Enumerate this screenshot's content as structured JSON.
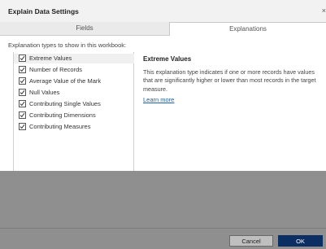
{
  "window": {
    "title": "Explain Data Settings"
  },
  "tabs": [
    {
      "label": "Fields"
    },
    {
      "label": "Explanations"
    }
  ],
  "section_label": "Explanation types to show in this workbook:",
  "explanation_types": [
    {
      "label": "Extreme Values",
      "checked": true,
      "selected": true
    },
    {
      "label": "Number of Records",
      "checked": true
    },
    {
      "label": "Average Value of the Mark",
      "checked": true
    },
    {
      "label": "Null Values",
      "checked": true
    },
    {
      "label": "Contributing Single Values",
      "checked": true
    },
    {
      "label": "Contributing Dimensions",
      "checked": true
    },
    {
      "label": "Contributing Measures",
      "checked": true
    }
  ],
  "detail": {
    "title": "Extreme Values",
    "body": "This explanation type indicates if one or more records have values that are significantly higher or lower than most records in the target measure.",
    "link_label": "Learn more"
  },
  "buttons": {
    "cancel_label": "Cancel",
    "ok_label": "OK"
  },
  "colors": {
    "ok_button": "#0b2f63",
    "link": "#1f5fa8",
    "overlay_gray": "#8f8f8f"
  }
}
